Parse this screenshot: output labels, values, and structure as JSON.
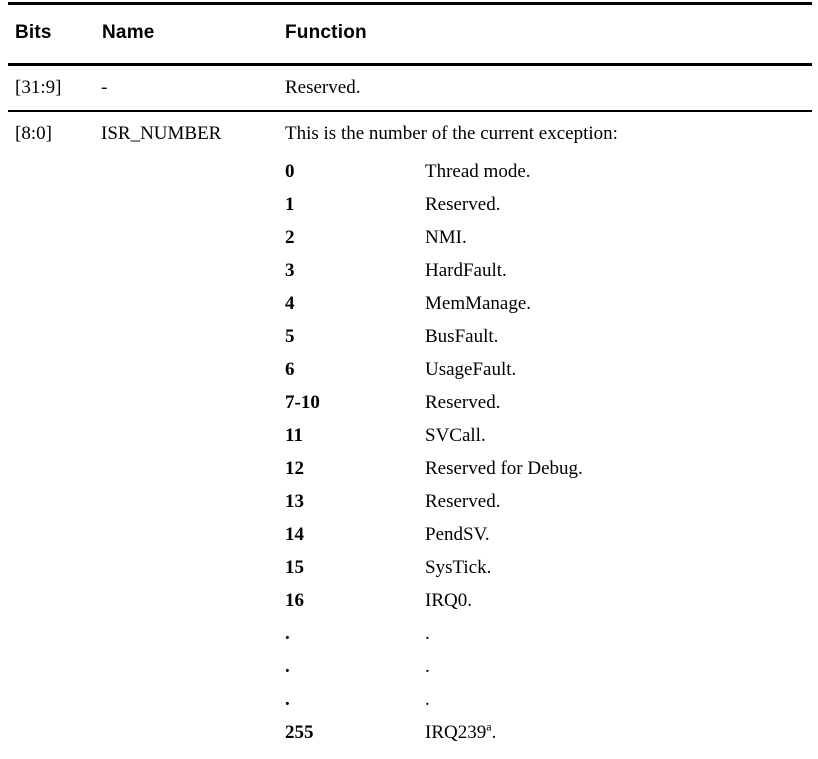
{
  "table": {
    "headers": {
      "bits": "Bits",
      "name": "Name",
      "function": "Function"
    },
    "rows": [
      {
        "bits": "[31:9]",
        "name": "-",
        "function": "Reserved."
      },
      {
        "bits": "[8:0]",
        "name": "ISR_NUMBER",
        "function": "This is the number of the current exception:"
      }
    ],
    "isr_values": [
      {
        "number": "0",
        "description": "Thread mode."
      },
      {
        "number": "1",
        "description": "Reserved."
      },
      {
        "number": "2",
        "description": "NMI."
      },
      {
        "number": "3",
        "description": "HardFault."
      },
      {
        "number": "4",
        "description": "MemManage."
      },
      {
        "number": "5",
        "description": "BusFault."
      },
      {
        "number": "6",
        "description": "UsageFault."
      },
      {
        "number": "7-10",
        "description": "Reserved."
      },
      {
        "number": "11",
        "description": "SVCall."
      },
      {
        "number": "12",
        "description": "Reserved for Debug."
      },
      {
        "number": "13",
        "description": "Reserved."
      },
      {
        "number": "14",
        "description": "PendSV."
      },
      {
        "number": "15",
        "description": "SysTick."
      },
      {
        "number": "16",
        "description": "IRQ0."
      },
      {
        "number": ".",
        "description": "."
      },
      {
        "number": ".",
        "description": "."
      },
      {
        "number": ".",
        "description": "."
      },
      {
        "number": "255",
        "description": "IRQ239",
        "footnote": "a",
        "suffix": "."
      }
    ]
  },
  "colors": {
    "text": "#000000",
    "rule": "#000000",
    "background": "#ffffff"
  }
}
